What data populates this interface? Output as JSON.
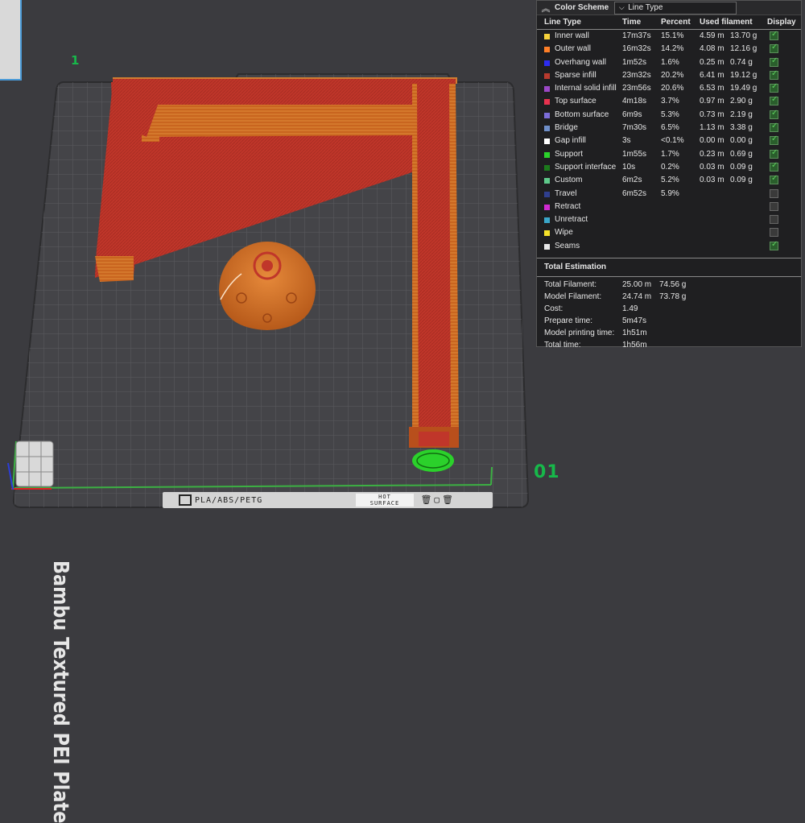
{
  "viewport": {
    "plate_number": "1",
    "plate_id": "01",
    "plate_name": "Bambu Textured PEI Plate",
    "filament_label": "PLA/ABS/PETG",
    "surface_label": [
      "HOT",
      "SURFACE"
    ]
  },
  "legend": {
    "title": "Color Scheme",
    "scheme_selected": "Line Type",
    "columns": [
      "Line Type",
      "Time",
      "Percent",
      "Used filament",
      "Display"
    ],
    "rows": [
      {
        "name": "Inner wall",
        "color": "#f7d23b",
        "time": "17m37s",
        "percent": "15.1%",
        "length": "4.59 m",
        "weight": "13.70 g",
        "display": true
      },
      {
        "name": "Outer wall",
        "color": "#ff7f27",
        "time": "16m32s",
        "percent": "14.2%",
        "length": "4.08 m",
        "weight": "12.16 g",
        "display": true
      },
      {
        "name": "Overhang wall",
        "color": "#2c2cf0",
        "time": "1m52s",
        "percent": "1.6%",
        "length": "0.25 m",
        "weight": "0.74 g",
        "display": true
      },
      {
        "name": "Sparse infill",
        "color": "#b83a2e",
        "time": "23m32s",
        "percent": "20.2%",
        "length": "6.41 m",
        "weight": "19.12 g",
        "display": true
      },
      {
        "name": "Internal solid infill",
        "color": "#9b48c7",
        "time": "23m56s",
        "percent": "20.6%",
        "length": "6.53 m",
        "weight": "19.49 g",
        "display": true
      },
      {
        "name": "Top surface",
        "color": "#e8324f",
        "time": "4m18s",
        "percent": "3.7%",
        "length": "0.97 m",
        "weight": "2.90 g",
        "display": true
      },
      {
        "name": "Bottom surface",
        "color": "#7b6cd8",
        "time": "6m9s",
        "percent": "5.3%",
        "length": "0.73 m",
        "weight": "2.19 g",
        "display": true
      },
      {
        "name": "Bridge",
        "color": "#6f8fc9",
        "time": "7m30s",
        "percent": "6.5%",
        "length": "1.13 m",
        "weight": "3.38 g",
        "display": true
      },
      {
        "name": "Gap infill",
        "color": "#ffffff",
        "time": "3s",
        "percent": "<0.1%",
        "length": "0.00 m",
        "weight": "0.00 g",
        "display": true
      },
      {
        "name": "Support",
        "color": "#2bd12b",
        "time": "1m55s",
        "percent": "1.7%",
        "length": "0.23 m",
        "weight": "0.69 g",
        "display": true
      },
      {
        "name": "Support interface",
        "color": "#1c7a1c",
        "time": "10s",
        "percent": "0.2%",
        "length": "0.03 m",
        "weight": "0.09 g",
        "display": true
      },
      {
        "name": "Custom",
        "color": "#5ec98a",
        "time": "6m2s",
        "percent": "5.2%",
        "length": "0.03 m",
        "weight": "0.09 g",
        "display": true
      },
      {
        "name": "Travel",
        "color": "#2f3f8f",
        "time": "6m52s",
        "percent": "5.9%",
        "length": "",
        "weight": "",
        "display": false
      },
      {
        "name": "Retract",
        "color": "#d02ad0",
        "time": "",
        "percent": "",
        "length": "",
        "weight": "",
        "display": false
      },
      {
        "name": "Unretract",
        "color": "#3aa6c9",
        "time": "",
        "percent": "",
        "length": "",
        "weight": "",
        "display": false
      },
      {
        "name": "Wipe",
        "color": "#f5e12a",
        "time": "",
        "percent": "",
        "length": "",
        "weight": "",
        "display": false
      },
      {
        "name": "Seams",
        "color": "#e8e8e8",
        "time": "",
        "percent": "",
        "length": "",
        "weight": "",
        "display": true
      }
    ],
    "total_title": "Total Estimation",
    "totals": [
      {
        "label": "Total Filament:",
        "v1": "25.00 m",
        "v2": "74.56 g"
      },
      {
        "label": "Model Filament:",
        "v1": "24.74 m",
        "v2": "73.78 g"
      },
      {
        "label": "Cost:",
        "v1": "1.49",
        "v2": ""
      },
      {
        "label": "Prepare time:",
        "v1": "5m47s",
        "v2": ""
      },
      {
        "label": "Model printing time:",
        "v1": "1h51m",
        "v2": ""
      },
      {
        "label": "Total time:",
        "v1": "1h56m",
        "v2": ""
      }
    ]
  }
}
